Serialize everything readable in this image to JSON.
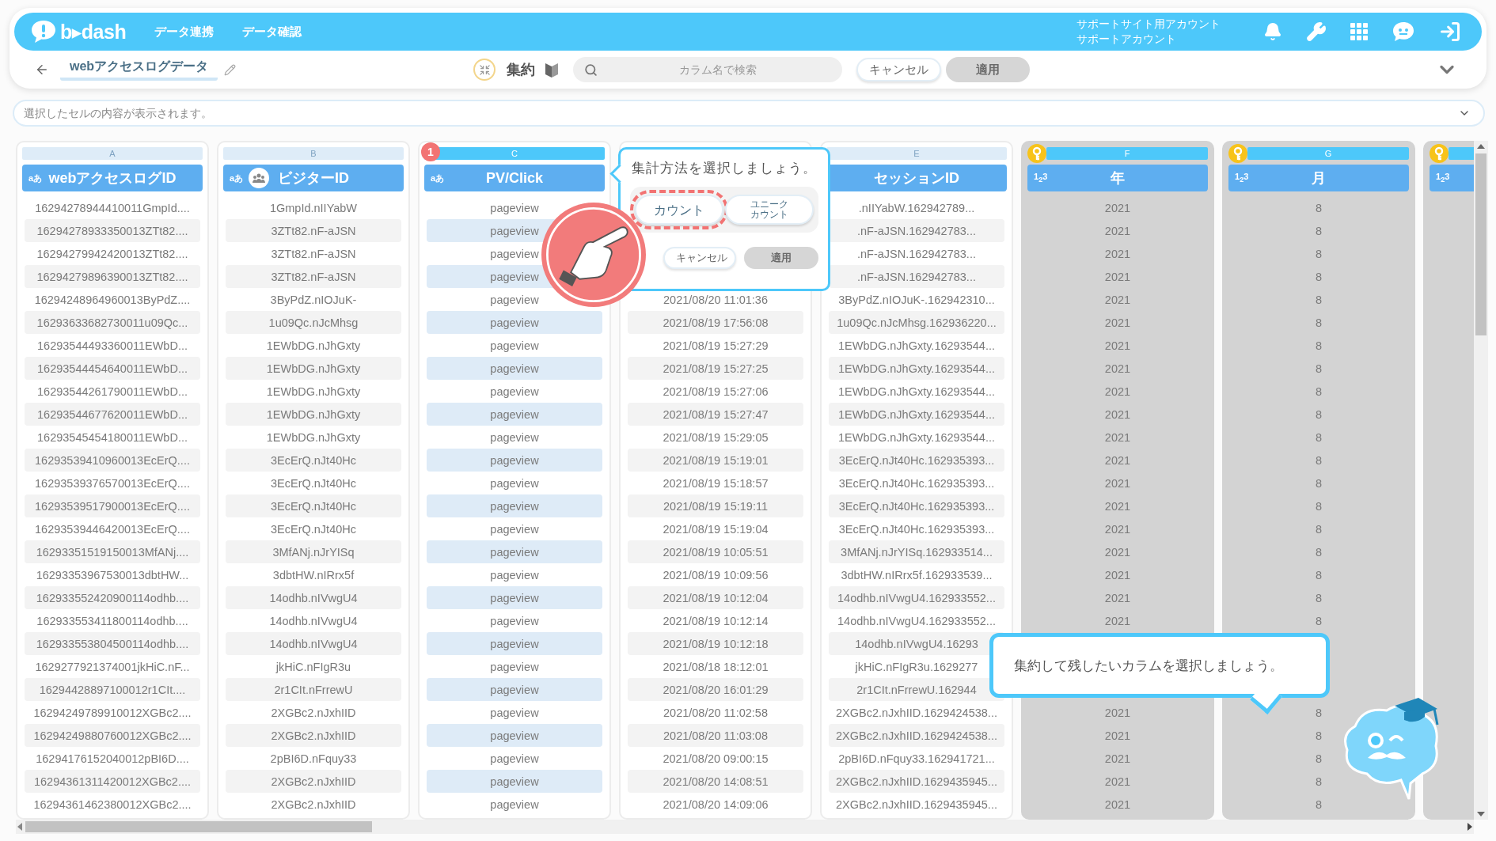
{
  "header": {
    "logo": "b▸dash",
    "nav": [
      {
        "label": "データ連携"
      },
      {
        "label": "データ確認"
      }
    ],
    "account": [
      "サポートサイト用アカウント",
      "サポートアカウント"
    ]
  },
  "toolbar": {
    "title": "webアクセスログデータ",
    "aggregate_label": "集約",
    "search": {
      "placeholder": "カラム名で検索"
    },
    "cancel": "キャンセル",
    "apply": {
      "label": "適用",
      "disabled": true
    }
  },
  "cell_viewer": {
    "placeholder": "選択したセルの内容が表示されます。"
  },
  "columns": [
    {
      "letter": "A",
      "type_label": "aあ",
      "name": "webアクセスログID",
      "highlighted": false,
      "greyed": false,
      "cells": [
        "16294278944410011GmpId....",
        "16294278933350013ZTt82....",
        "16294279942420013ZTt82....",
        "16294279896390013ZTt82....",
        "16294248964960013ByPdZ....",
        "16293633682730011u09Qc...",
        "16293544493360011EWbD...",
        "16293544454640011EWbD...",
        "16293544261790011EWbD...",
        "16293544677620011EWbD...",
        "16293545454180011EWbD...",
        "16293539410960013EcErQ....",
        "16293539376570013EcErQ....",
        "16293539517900013EcErQ....",
        "16293539446420013EcErQ....",
        "16293351519150013MfANj....",
        "16293353967530013dbtHW...",
        "162933552420900114odhb....",
        "162933553411800114odhb....",
        "162933553804500114odhb....",
        "1629277921374001jkHiC.nF...",
        "16294428897100012r1CIt....",
        "16294249789910012XGBc2....",
        "16294249880760012XGBc2....",
        "16294176152040012pBI6D....",
        "16294361311420012XGBc2....",
        "16294361462380012XGBc2...."
      ]
    },
    {
      "letter": "B",
      "type_label": "aあ",
      "name": "ビジターID",
      "highlighted": false,
      "greyed": false,
      "id_icon": true,
      "cells": [
        "1GmpId.nIIYabW",
        "3ZTt82.nF-aJSN",
        "3ZTt82.nF-aJSN",
        "3ZTt82.nF-aJSN",
        "3ByPdZ.nIOJuK-",
        "1u09Qc.nJcMhsg",
        "1EWbDG.nJhGxty",
        "1EWbDG.nJhGxty",
        "1EWbDG.nJhGxty",
        "1EWbDG.nJhGxty",
        "1EWbDG.nJhGxty",
        "3EcErQ.nJt40Hc",
        "3EcErQ.nJt40Hc",
        "3EcErQ.nJt40Hc",
        "3EcErQ.nJt40Hc",
        "3MfANj.nJrYISq",
        "3dbtHW.nIRrx5f",
        "14odhb.nIVwgU4",
        "14odhb.nIVwgU4",
        "14odhb.nIVwgU4",
        "jkHiC.nFIgR3u",
        "2r1CIt.nFrrewU",
        "2XGBc2.nJxhIID",
        "2XGBc2.nJxhIID",
        "2pBI6D.nFquy33",
        "2XGBc2.nJxhIID",
        "2XGBc2.nJxhIID"
      ]
    },
    {
      "letter": "C",
      "type_label": "aあ",
      "name": "PV/Click",
      "highlighted": true,
      "greyed": false,
      "badge": "1",
      "cells": [
        "pageview",
        "pageview",
        "pageview",
        "pageview",
        "pageview",
        "pageview",
        "pageview",
        "pageview",
        "pageview",
        "pageview",
        "pageview",
        "pageview",
        "pageview",
        "pageview",
        "pageview",
        "pageview",
        "pageview",
        "pageview",
        "pageview",
        "pageview",
        "pageview",
        "pageview",
        "pageview",
        "pageview",
        "pageview",
        "pageview",
        "pageview"
      ]
    },
    {
      "greyed": false,
      "cells": [
        null,
        null,
        null,
        null,
        "2021/08/20 11:01:36",
        "2021/08/19 17:56:08",
        "2021/08/19 15:27:29",
        "2021/08/19 15:27:25",
        "2021/08/19 15:27:06",
        "2021/08/19 15:27:47",
        "2021/08/19 15:29:05",
        "2021/08/19 15:19:01",
        "2021/08/19 15:18:57",
        "2021/08/19 15:19:11",
        "2021/08/19 15:19:04",
        "2021/08/19 10:05:51",
        "2021/08/19 10:09:56",
        "2021/08/19 10:12:04",
        "2021/08/19 10:12:14",
        "2021/08/19 10:12:18",
        "2021/08/18 18:12:01",
        "2021/08/20 16:01:29",
        "2021/08/20 11:02:58",
        "2021/08/20 11:03:08",
        "2021/08/20 09:00:15",
        "2021/08/20 14:08:51",
        "2021/08/20 14:09:06"
      ]
    },
    {
      "letter": "E",
      "name": "セッションID",
      "highlighted": false,
      "greyed": false,
      "cells": [
        ".nIIYabW.162942789...",
        ".nF-aJSN.162942783...",
        ".nF-aJSN.162942783...",
        ".nF-aJSN.162942783...",
        "3ByPdZ.nIOJuK-.162942310...",
        "1u09Qc.nJcMhsg.162936220...",
        "1EWbDG.nJhGxty.16293544...",
        "1EWbDG.nJhGxty.16293544...",
        "1EWbDG.nJhGxty.16293544...",
        "1EWbDG.nJhGxty.16293544...",
        "1EWbDG.nJhGxty.16293544...",
        "3EcErQ.nJt40Hc.162935393...",
        "3EcErQ.nJt40Hc.162935393...",
        "3EcErQ.nJt40Hc.162935393...",
        "3EcErQ.nJt40Hc.162935393...",
        "3MfANj.nJrYISq.162933514...",
        "3dbtHW.nIRrx5f.162933539...",
        "14odhb.nIVwgU4.162933552...",
        "14odhb.nIVwgU4.162933552...",
        "14odhb.nIVwgU4.16293",
        "jkHiC.nFIgR3u.1629277",
        "2r1CIt.nFrrewU.162944",
        "2XGBc2.nJxhIID.1629424538...",
        "2XGBc2.nJxhIID.1629424538...",
        "2pBI6D.nFquy33.162941721...",
        "2XGBc2.nJxhIID.1629435945...",
        "2XGBc2.nJxhIID.1629435945..."
      ]
    },
    {
      "letter": "F",
      "type_label": "1$_{2}$3",
      "name": "年",
      "highlighted": true,
      "greyed": true,
      "key": true,
      "cells": [
        "2021",
        "2021",
        "2021",
        "2021",
        "2021",
        "2021",
        "2021",
        "2021",
        "2021",
        "2021",
        "2021",
        "2021",
        "2021",
        "2021",
        "2021",
        "2021",
        "2021",
        "2021",
        "2021",
        null,
        null,
        null,
        "2021",
        "2021",
        "2021",
        "2021",
        "2021"
      ]
    },
    {
      "letter": "G",
      "type_label": "1$_{2}$3",
      "name": "月",
      "highlighted": true,
      "greyed": true,
      "key": true,
      "cells": [
        "8",
        "8",
        "8",
        "8",
        "8",
        "8",
        "8",
        "8",
        "8",
        "8",
        "8",
        "8",
        "8",
        "8",
        "8",
        "8",
        "8",
        "8",
        "8",
        null,
        null,
        null,
        "8",
        "8",
        "8",
        "8",
        "8"
      ]
    },
    {
      "type_label": "1$_{2}$3",
      "highlighted": true,
      "greyed": true,
      "key": true
    }
  ],
  "popover": {
    "title": "集計方法を選択しましょう。",
    "options": [
      {
        "label": "カウント",
        "selected": true
      },
      {
        "label": "ユニークカウント",
        "selected": false
      }
    ],
    "cancel": "キャンセル",
    "apply": {
      "label": "適用",
      "disabled": true
    }
  },
  "hint_bubble": {
    "text": "集約して残したいカラムを選択しましょう。"
  }
}
